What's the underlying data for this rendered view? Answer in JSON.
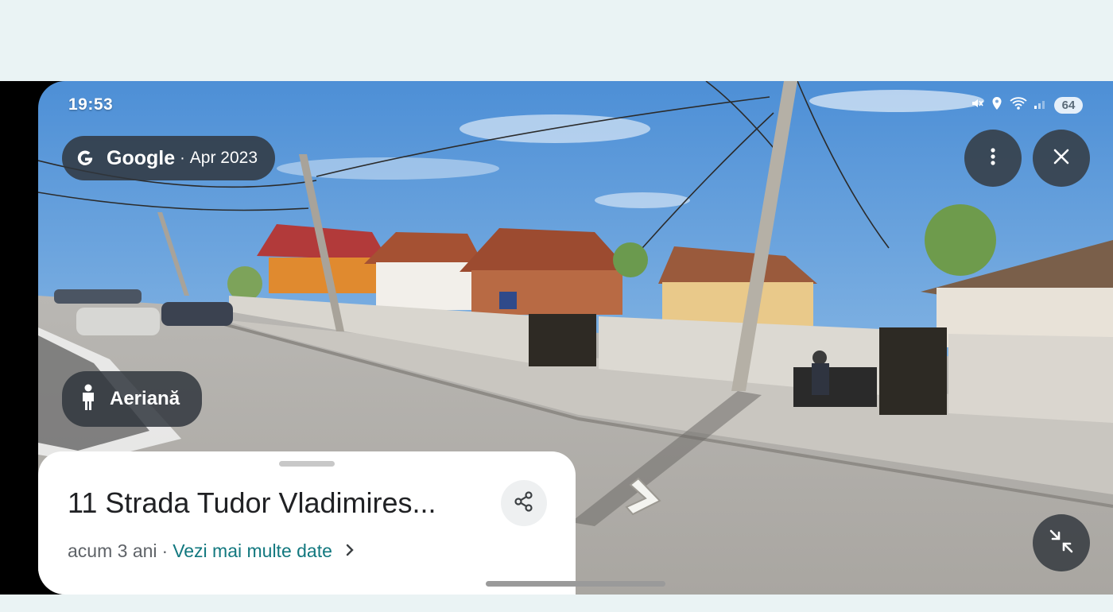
{
  "status_bar": {
    "time": "19:53",
    "battery": "64"
  },
  "source": {
    "brand": "Google",
    "separator": "·",
    "date": "Apr 2023"
  },
  "aerial_button": {
    "label": "Aeriană"
  },
  "place": {
    "title": "11 Strada Tudor Vladimires...",
    "age": "acum 3 ani",
    "separator": "·",
    "more_dates": "Vezi mai multe date"
  },
  "icons": {
    "google": "google-g-icon",
    "more": "more-vert-icon",
    "close": "close-icon",
    "pegman": "pegman-icon",
    "share": "share-icon",
    "chevron": "chevron-right-icon",
    "collapse": "collapse-icon",
    "nav_arrow": "street-view-arrow-icon"
  },
  "colors": {
    "link": "#12787f",
    "overlay": "#30363d",
    "sky": "#6fa3d8"
  }
}
